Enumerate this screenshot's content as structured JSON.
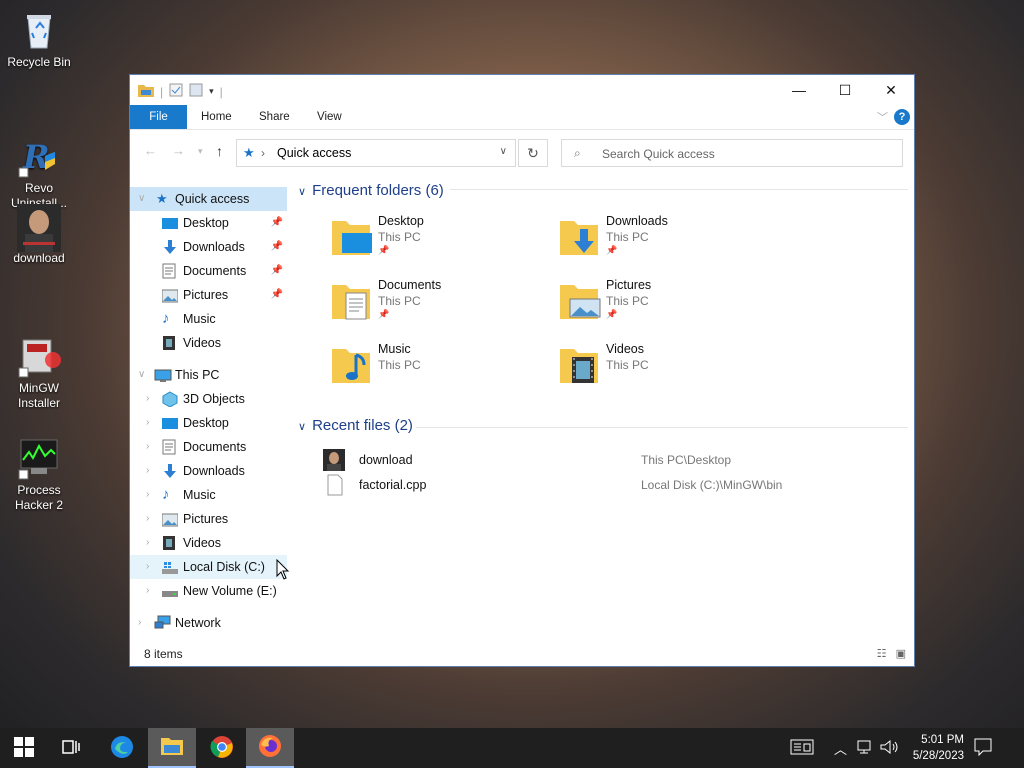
{
  "desktop": {
    "icons": [
      {
        "label": "Recycle Bin",
        "icon": "recycle-bin-icon"
      },
      {
        "label": "Revo\nUninstall...",
        "icon": "revo-uninstaller-icon"
      },
      {
        "label": "download",
        "icon": "image-thumbnail-icon"
      },
      {
        "label": "MinGW\nInstaller",
        "icon": "mingw-installer-icon"
      },
      {
        "label": "Process\nHacker 2",
        "icon": "process-hacker-icon"
      }
    ]
  },
  "window": {
    "ribbon": {
      "file": "File",
      "home": "Home",
      "share": "Share",
      "view": "View",
      "help": "?"
    },
    "controls": {
      "minimize": "—",
      "maximize": "☐",
      "close": "✕"
    },
    "address": {
      "path": "Quick access"
    },
    "search": {
      "placeholder": "Search Quick access"
    },
    "nav": {
      "quick_access": "Quick access",
      "quick_items": [
        {
          "label": "Desktop",
          "pinned": true
        },
        {
          "label": "Downloads",
          "pinned": true
        },
        {
          "label": "Documents",
          "pinned": true
        },
        {
          "label": "Pictures",
          "pinned": true
        },
        {
          "label": "Music",
          "pinned": false
        },
        {
          "label": "Videos",
          "pinned": false
        }
      ],
      "this_pc": "This PC",
      "pc_items": [
        {
          "label": "3D Objects"
        },
        {
          "label": "Desktop"
        },
        {
          "label": "Documents"
        },
        {
          "label": "Downloads"
        },
        {
          "label": "Music"
        },
        {
          "label": "Pictures"
        },
        {
          "label": "Videos"
        },
        {
          "label": "Local Disk (C:)"
        },
        {
          "label": "New Volume (E:)"
        }
      ],
      "network": "Network"
    },
    "frequent": {
      "header": "Frequent folders (6)",
      "folders": [
        {
          "name": "Desktop",
          "location": "This PC",
          "pinned": true
        },
        {
          "name": "Downloads",
          "location": "This PC",
          "pinned": true
        },
        {
          "name": "Documents",
          "location": "This PC",
          "pinned": true
        },
        {
          "name": "Pictures",
          "location": "This PC",
          "pinned": true
        },
        {
          "name": "Music",
          "location": "This PC",
          "pinned": false
        },
        {
          "name": "Videos",
          "location": "This PC",
          "pinned": false
        }
      ]
    },
    "recent": {
      "header": "Recent files (2)",
      "files": [
        {
          "name": "download",
          "path": "This PC\\Desktop",
          "icon": "image-thumbnail-icon"
        },
        {
          "name": "factorial.cpp",
          "path": "Local Disk (C:)\\MinGW\\bin",
          "icon": "file-icon"
        }
      ]
    },
    "status": {
      "items_count": "8 items"
    }
  },
  "taskbar": {
    "clock_time": "5:01 PM",
    "clock_date": "5/28/2023"
  },
  "colors": {
    "accent": "#1979ca",
    "selection": "#cce4f7",
    "header_text": "#1e3f8a",
    "taskbar": "#1f1f1f"
  }
}
